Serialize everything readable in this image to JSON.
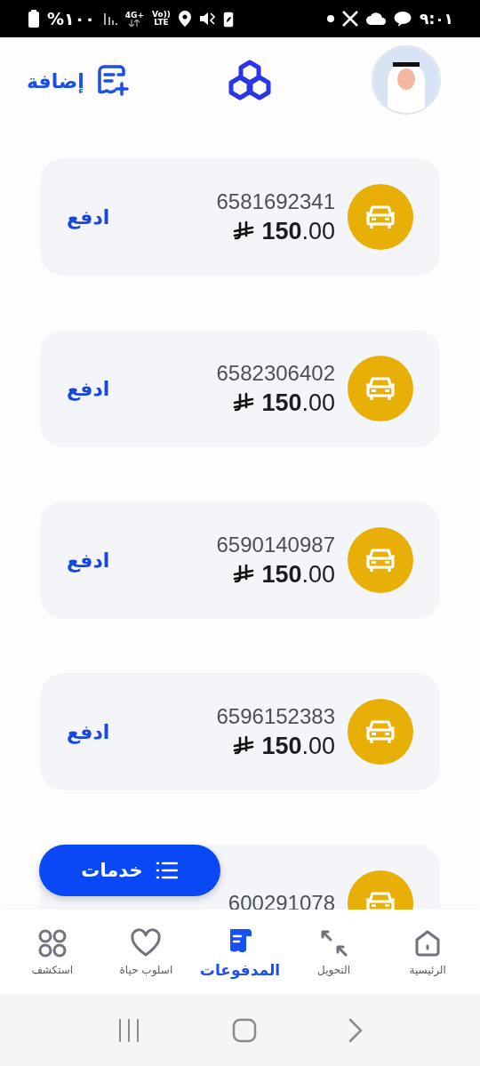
{
  "status_bar": {
    "battery": "%١٠٠",
    "network": "4G+",
    "volte_top": "Vo))",
    "volte_bottom": "LTE",
    "time": "٩:٠١"
  },
  "header": {
    "add_label": "إضافة"
  },
  "payments": [
    {
      "number": "6581692341",
      "amount": "**150**.00",
      "pay_label": "ادفع"
    },
    {
      "number": "6582306402",
      "amount": "**150**.00",
      "pay_label": "ادفع"
    },
    {
      "number": "6590140987",
      "amount": "**150**.00",
      "pay_label": "ادفع"
    },
    {
      "number": "6596152383",
      "amount": "**150**.00",
      "pay_label": "ادفع"
    },
    {
      "number": "600291078"
    }
  ],
  "services_button": {
    "label": "خدمات"
  },
  "bottom_nav": [
    {
      "label": "الرئيسية",
      "selected": false
    },
    {
      "label": "التحويل",
      "selected": false
    },
    {
      "label": "المدفوعات",
      "selected": true
    },
    {
      "label": "اسلوب حياة",
      "selected": false
    },
    {
      "label": "استكشف",
      "selected": false
    }
  ]
}
